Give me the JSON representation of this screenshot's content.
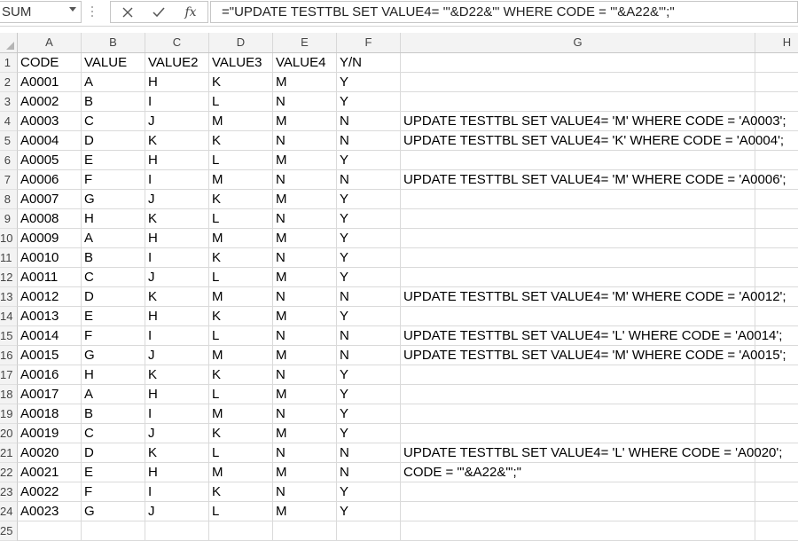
{
  "formula_bar": {
    "name_box": "SUM",
    "cancel_icon": "close-icon",
    "enter_icon": "checkmark-icon",
    "function_label": "fx",
    "formula": "=\"UPDATE TESTTBL SET VALUE4= '\"&D22&\"' WHERE CODE = '\"&A22&\"';\""
  },
  "columns": [
    "A",
    "B",
    "C",
    "D",
    "E",
    "F",
    "G",
    "H"
  ],
  "row_numbers": [
    "1",
    "2",
    "3",
    "4",
    "5",
    "6",
    "7",
    "8",
    "9",
    "10",
    "11",
    "12",
    "13",
    "14",
    "15",
    "16",
    "17",
    "18",
    "19",
    "20",
    "21",
    "22",
    "23",
    "24",
    "25"
  ],
  "rows": [
    [
      "CODE",
      "VALUE",
      "VALUE2",
      "VALUE3",
      "VALUE4",
      "Y/N",
      ""
    ],
    [
      "A0001",
      "A",
      "H",
      "K",
      "M",
      "Y",
      ""
    ],
    [
      "A0002",
      "B",
      "I",
      "L",
      "N",
      "Y",
      ""
    ],
    [
      "A0003",
      "C",
      "J",
      "M",
      "M",
      "N",
      "UPDATE TESTTBL SET VALUE4= 'M' WHERE CODE = 'A0003';"
    ],
    [
      "A0004",
      "D",
      "K",
      "K",
      "N",
      "N",
      "UPDATE TESTTBL SET VALUE4= 'K' WHERE CODE = 'A0004';"
    ],
    [
      "A0005",
      "E",
      "H",
      "L",
      "M",
      "Y",
      ""
    ],
    [
      "A0006",
      "F",
      "I",
      "M",
      "N",
      "N",
      "UPDATE TESTTBL SET VALUE4= 'M' WHERE CODE = 'A0006';"
    ],
    [
      "A0007",
      "G",
      "J",
      "K",
      "M",
      "Y",
      ""
    ],
    [
      "A0008",
      "H",
      "K",
      "L",
      "N",
      "Y",
      ""
    ],
    [
      "A0009",
      "A",
      "H",
      "M",
      "M",
      "Y",
      ""
    ],
    [
      "A0010",
      "B",
      "I",
      "K",
      "N",
      "Y",
      ""
    ],
    [
      "A0011",
      "C",
      "J",
      "L",
      "M",
      "Y",
      ""
    ],
    [
      "A0012",
      "D",
      "K",
      "M",
      "N",
      "N",
      "UPDATE TESTTBL SET VALUE4= 'M' WHERE CODE = 'A0012';"
    ],
    [
      "A0013",
      "E",
      "H",
      "K",
      "M",
      "Y",
      ""
    ],
    [
      "A0014",
      "F",
      "I",
      "L",
      "N",
      "N",
      "UPDATE TESTTBL SET VALUE4= 'L' WHERE CODE = 'A0014';"
    ],
    [
      "A0015",
      "G",
      "J",
      "M",
      "M",
      "N",
      "UPDATE TESTTBL SET VALUE4= 'M' WHERE CODE = 'A0015';"
    ],
    [
      "A0016",
      "H",
      "K",
      "K",
      "N",
      "Y",
      ""
    ],
    [
      "A0017",
      "A",
      "H",
      "L",
      "M",
      "Y",
      ""
    ],
    [
      "A0018",
      "B",
      "I",
      "M",
      "N",
      "Y",
      ""
    ],
    [
      "A0019",
      "C",
      "J",
      "K",
      "M",
      "Y",
      ""
    ],
    [
      "A0020",
      "D",
      "K",
      "L",
      "N",
      "N",
      "UPDATE TESTTBL SET VALUE4= 'L' WHERE CODE = 'A0020';"
    ],
    [
      "A0021",
      "E",
      "H",
      "M",
      "M",
      "N",
      "CODE = '\"&A22&\"';\""
    ],
    [
      "A0022",
      "F",
      "I",
      "K",
      "N",
      "Y",
      ""
    ],
    [
      "A0023",
      "G",
      "J",
      "L",
      "M",
      "Y",
      ""
    ],
    [
      "",
      "",
      "",
      "",
      "",
      "",
      ""
    ]
  ]
}
